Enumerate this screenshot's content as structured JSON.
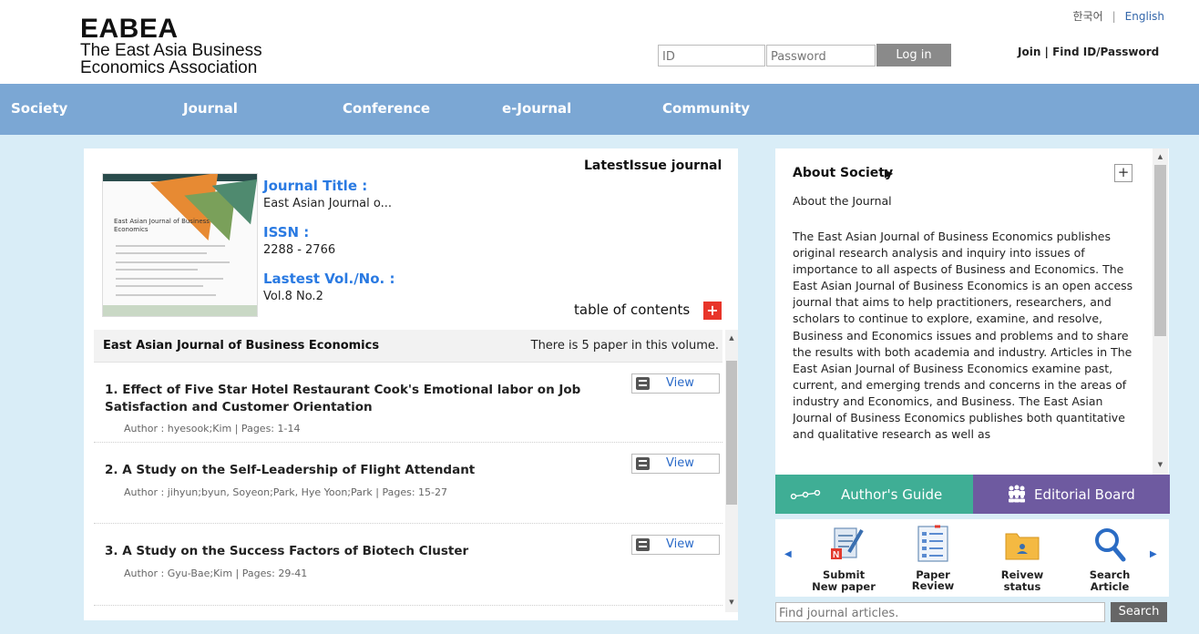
{
  "header": {
    "brand": "EABEA",
    "subtitle_line1": "The East Asia Business",
    "subtitle_line2": "Economics Association",
    "lang_korean": "한국어",
    "lang_sep": "|",
    "lang_english": "English",
    "id_placeholder": "ID",
    "password_placeholder": "Password",
    "login_label": "Log in",
    "join_label": "Join | Find ID/Password"
  },
  "nav": {
    "items": [
      "Society",
      "Journal",
      "Conference",
      "e-Journal",
      "Community"
    ]
  },
  "journal": {
    "latest_label": "LatestIssue journal",
    "cover_title": "East Asian Journal of Business Economics",
    "title_label": "Journal Title :",
    "title_value": "East Asian Journal o...",
    "issn_label": "ISSN :",
    "issn_value": "2288 - 2766",
    "vol_label": "Lastest Vol./No. :",
    "vol_value": "Vol.8  No.2",
    "toc_label": "table of contents",
    "toc_plus": "+"
  },
  "volume": {
    "title": "East Asian Journal of Business Economics",
    "count_text": "There is 5 paper in this volume."
  },
  "papers": [
    {
      "title": "1. Effect of Five Star Hotel Restaurant Cook's Emotional labor on Job Satisfaction and Customer Orientation",
      "meta": "Author : hyesook;Kim | Pages: 1-14",
      "view": "View"
    },
    {
      "title": "2. A Study on the Self-Leadership of Flight Attendant",
      "meta": "Author : jihyun;byun, Soyeon;Park, Hye Yoon;Park | Pages: 15-27",
      "view": "View"
    },
    {
      "title": "3. A Study on the Success Factors of Biotech Cluster",
      "meta": "Author : Gyu-Bae;Kim | Pages: 29-41",
      "view": "View"
    }
  ],
  "about": {
    "title": "About Society",
    "arrow": "▶",
    "plus": "+",
    "subtitle": "About the Journal",
    "body": "The East Asian Journal of Business Economics publishes original research analysis and inquiry into issues of importance to all aspects of Business and Economics. The East Asian Journal of Business Economics is an open access journal that aims to help practitioners, researchers, and scholars to continue to explore, examine, and resolve, Business and Economics issues and problems and to share the results with both academia and industry. Articles in The East Asian Journal of Business Economics examine past, current, and emerging trends and concerns in the areas of industry and Economics, and Business. The East Asian Journal of Business Economics publishes both quantitative and qualitative research as well as"
  },
  "buttons": {
    "authors_guide": "Author's Guide",
    "editorial_board": "Editorial Board"
  },
  "quick_links": {
    "left_arrow": "◀",
    "right_arrow": "▶",
    "items": [
      {
        "label_line1": "Submit",
        "label_line2": "New paper",
        "icon": "submit-paper-icon"
      },
      {
        "label_line1": "",
        "label_line2": "Paper Review",
        "icon": "paper-review-icon"
      },
      {
        "label_line1": "Reivew",
        "label_line2": "status",
        "icon": "review-status-icon"
      },
      {
        "label_line1": "Search",
        "label_line2": "Article",
        "icon": "search-article-icon"
      }
    ]
  },
  "search": {
    "placeholder": "Find journal articles.",
    "button": "Search"
  },
  "colors": {
    "nav_bg": "#7ba7d4",
    "page_bg": "#d9edf7",
    "link_blue": "#2a7ae2",
    "guide_green": "#3fae95",
    "board_purple": "#6e5aa0",
    "toc_red": "#e8352a"
  }
}
